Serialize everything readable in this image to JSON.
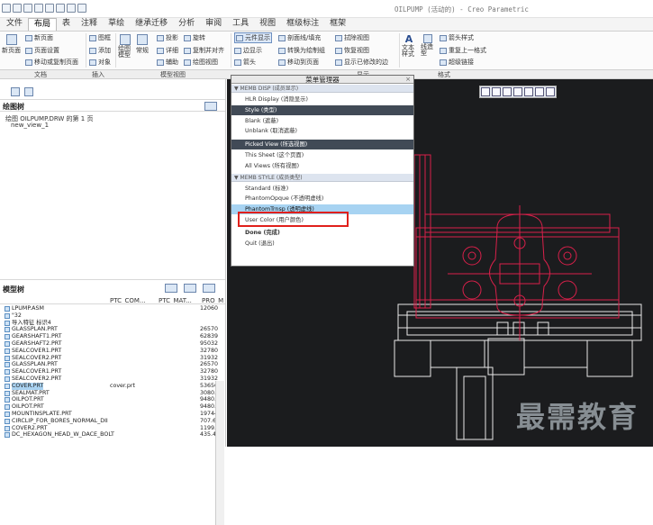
{
  "window_title": "OILPUMP (活动的) - Creo Parametric",
  "ribbon_tabs": [
    "文件",
    "布局",
    "表",
    "注释",
    "草绘",
    "继承迁移",
    "分析",
    "审阅",
    "工具",
    "视图",
    "框级标注",
    "框架"
  ],
  "active_tab": "布局",
  "ribbon": {
    "doc_big": "新页面",
    "doc_new_page": "新页面",
    "doc_page_setup": "页面设置",
    "doc_move_copy": "移动或复制页面",
    "doc_edge": "页面",
    "ins_frame": "图框",
    "ins_add": "添加",
    "ins_object": "对象",
    "mv_drawing_model": "绘图模型",
    "mv_normal": "常规",
    "mv_projection": "投影",
    "mv_rotate": "旋转",
    "mv_detail": "详细",
    "mv_copy_align": "复制并对齐",
    "mv_aux": "辅助",
    "mv_drawing_view": "绘图视图",
    "elem_display": "元件显示",
    "hatch_fill": "剖面线/填充",
    "edge_display": "边显示",
    "convert_draw": "转换为绘制组",
    "arrow": "箭头",
    "move_to_page": "移动到页面",
    "erase_view": "拭除视图",
    "restore_view": "恢复视图",
    "show_modified_edges": "显示已修改的边",
    "text_style": "文本样式",
    "line_style": "线造型",
    "arrow_style": "箭头样式",
    "repeat_format": "重复上一格式",
    "hyperlink": "超级链接"
  },
  "groups": {
    "document": "文档",
    "insert": "插入",
    "model_views": "模型视图",
    "display": "显示",
    "format": "格式"
  },
  "drawing_tree": {
    "title": "绘图树",
    "page_item": "绘图 OILPUMP.DRW 的第 1 页",
    "view_item": "new_view_1"
  },
  "model_tree": {
    "title": "模型树",
    "columns": [
      "PTC_COM...",
      "PTC_MAT...",
      "PRO_M"
    ],
    "rows": [
      {
        "name": "LPUMP.ASM",
        "common": "",
        "mass": "12060"
      },
      {
        "name": "\"32",
        "common": "",
        "mass": ""
      },
      {
        "name": "导入特征 标识4",
        "common": "",
        "mass": ""
      },
      {
        "name": "GLASSPLAN.PRT",
        "common": "",
        "mass": "26570"
      },
      {
        "name": "GEARSHAFT1.PRT",
        "common": "",
        "mass": "62839"
      },
      {
        "name": "GEARSHAFT2.PRT",
        "common": "",
        "mass": "95032"
      },
      {
        "name": "SEALCOVER1.PRT",
        "common": "",
        "mass": "32780"
      },
      {
        "name": "SEALCOVER2.PRT",
        "common": "",
        "mass": "31932"
      },
      {
        "name": "GLASSPLAN.PRT",
        "common": "",
        "mass": "26570"
      },
      {
        "name": "SEALCOVER1.PRT",
        "common": "",
        "mass": "32780"
      },
      {
        "name": "SEALCOVER2.PRT",
        "common": "",
        "mass": "31932"
      },
      {
        "name": "COVER.PRT",
        "common": "cover.prt",
        "mass": "53656"
      },
      {
        "name": "SEALMAT.PRT",
        "common": "",
        "mass": "3080."
      },
      {
        "name": "OILPOT.PRT",
        "common": "",
        "mass": "9480.6"
      },
      {
        "name": "OILPOT.PRT",
        "common": "",
        "mass": "9480.6"
      },
      {
        "name": "MOUNTINSPLATE.PRT",
        "common": "",
        "mass": "19744"
      },
      {
        "name": "CIRCLIP_FOR_BORES_NORMAL_DII",
        "common": "",
        "mass": "707.6"
      },
      {
        "name": "COVER2.PRT",
        "common": "",
        "mass": "1199.9"
      },
      {
        "name": "DC_HEXAGON_HEAD_W_DACE_BOLT",
        "common": "",
        "mass": "435.4"
      }
    ]
  },
  "menu_manager": {
    "title": "菜单管理器",
    "sections": [
      {
        "header": "MEMB DISP (成员显示)",
        "items": [
          {
            "label": "HLR Display (消隐显示)",
            "style": "normal"
          },
          {
            "label": "Style (类型)",
            "style": "dark"
          },
          {
            "label": "Blank (遮蔽)",
            "style": "normal"
          },
          {
            "label": "Unblank (取消遮蔽)",
            "style": "normal"
          },
          {
            "label": "Picked View (所选视图)",
            "style": "dark"
          },
          {
            "label": "This Sheet (这个页面)",
            "style": "normal"
          },
          {
            "label": "All Views (所有视图)",
            "style": "normal"
          }
        ]
      },
      {
        "header": "MEMB STYLE (成员类型)",
        "items": [
          {
            "label": "Standard (标准)",
            "style": "normal"
          },
          {
            "label": "PhantomOpque (不透明虚线)",
            "style": "normal"
          },
          {
            "label": "PhantomTrnsp (透明虚线)",
            "style": "picked"
          },
          {
            "label": "User Color (用户颜色)",
            "style": "normal"
          },
          {
            "label": "Done (完成)",
            "style": "bold"
          },
          {
            "label": "Quit (退出)",
            "style": "normal"
          }
        ]
      }
    ]
  },
  "watermark": "最需教育",
  "colors": {
    "canvas_bg": "#1b1c1e",
    "drawing_red": "#d8204a",
    "drawing_white": "#e8e8e8",
    "menu_dark": "#414a56",
    "menu_picked": "#a7d3f2",
    "callout_red": "#e0201b"
  }
}
